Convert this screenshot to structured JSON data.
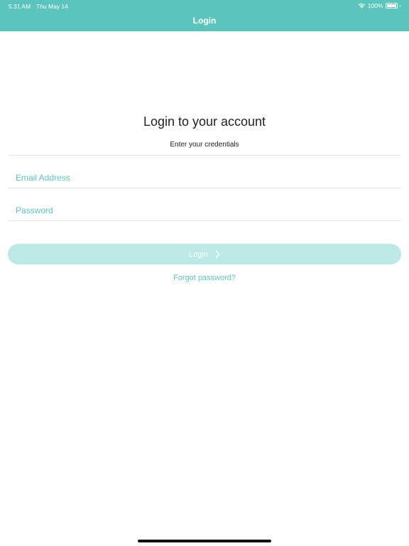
{
  "status_bar": {
    "time": "5:31 AM",
    "date": "Thu May 14",
    "battery_percent": "100%",
    "battery_level": 1.0,
    "wifi_icon": "wifi-icon",
    "battery_icon": "battery-icon"
  },
  "header": {
    "title": "Login",
    "background_color": "#5bc4bd"
  },
  "form": {
    "title": "Login to your account",
    "subtitle": "Enter your credentials",
    "email": {
      "value": "",
      "placeholder": "Email Address"
    },
    "password": {
      "value": "",
      "placeholder": "Password"
    },
    "login_button": {
      "label": "Login",
      "icon": "chevron-right-icon",
      "background_color": "#bce8e5"
    },
    "forgot_password": "Forgot password?"
  },
  "colors": {
    "accent": "#5bc4bd",
    "text_primary": "#222222",
    "divider": "#e3e3e3"
  }
}
